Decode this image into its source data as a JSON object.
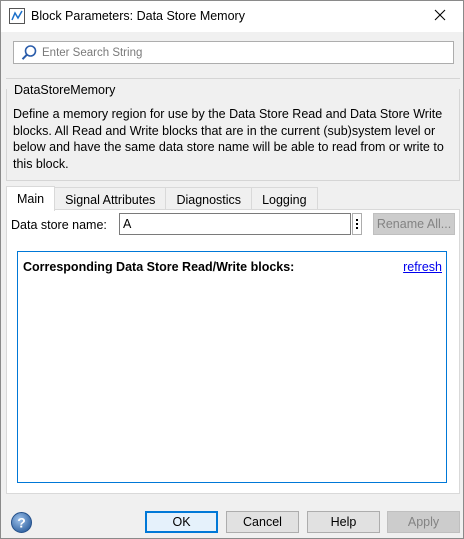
{
  "window": {
    "title": "Block Parameters: Data Store Memory"
  },
  "search": {
    "placeholder": "Enter Search String",
    "value": ""
  },
  "description": {
    "block_type": "DataStoreMemory",
    "text": "Define a memory region for use by the Data Store Read and Data Store Write blocks. All Read and Write blocks that are in the current (sub)system level or below and have the same data store name will be able to read from or write to this block."
  },
  "tabs": [
    {
      "label": "Main",
      "active": true
    },
    {
      "label": "Signal Attributes",
      "active": false
    },
    {
      "label": "Diagnostics",
      "active": false
    },
    {
      "label": "Logging",
      "active": false
    }
  ],
  "main": {
    "data_store_name_label": "Data store name:",
    "data_store_name_value": "A",
    "rename_all_label": "Rename All...",
    "corresponding_title": "Corresponding Data Store Read/Write blocks:",
    "refresh_label": "refresh"
  },
  "buttons": {
    "ok": "OK",
    "cancel": "Cancel",
    "help": "Help",
    "apply": "Apply"
  },
  "icons": {
    "app": "simulink-block-icon",
    "close": "close-icon",
    "search": "search-icon",
    "help": "help-icon"
  },
  "colors": {
    "accent": "#0078d7",
    "link": "#0000ee",
    "disabled_bg": "#cccccc",
    "disabled_text": "#838383"
  }
}
